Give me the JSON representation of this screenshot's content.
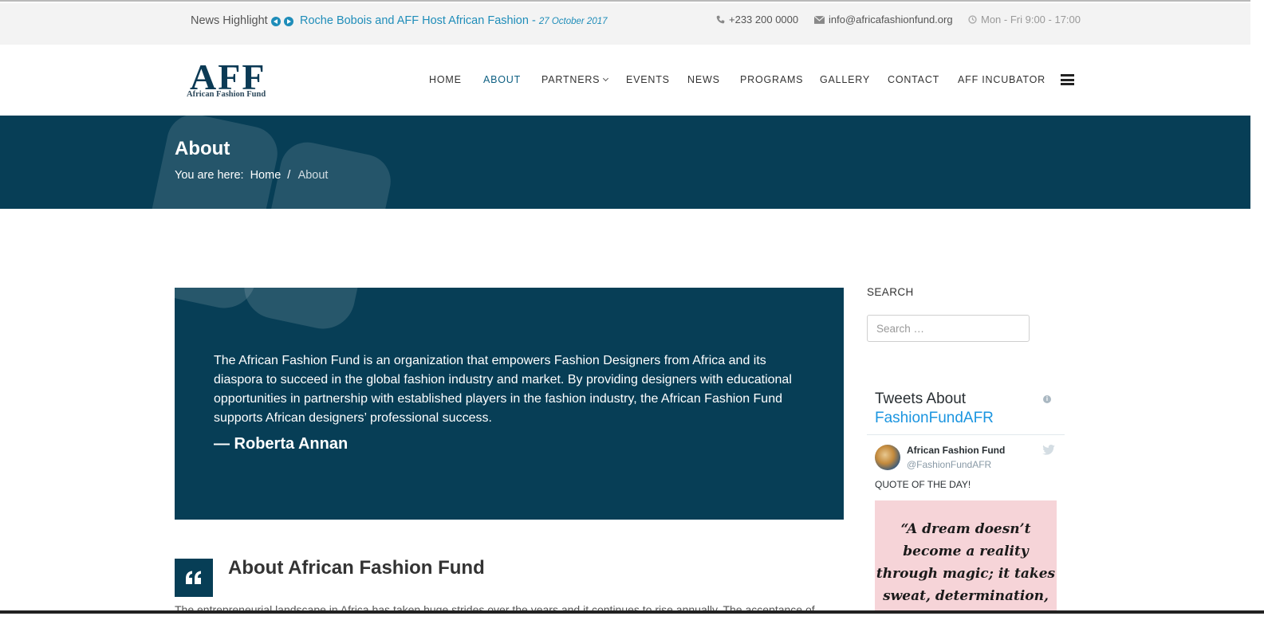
{
  "topbar": {
    "news_label": "News Highlight",
    "news_title": "Roche Bobois and AFF Host African Fashion",
    "news_dash": " - ",
    "news_date": "27 October 2017",
    "phone": "+233 200 0000",
    "email": "info@africafashionfund.org",
    "hours": "Mon - Fri 9:00 - 17:00"
  },
  "logo": {
    "mark": "AFF",
    "subtitle": "African Fashion Fund"
  },
  "nav": {
    "items": [
      {
        "label": "HOME"
      },
      {
        "label": "ABOUT"
      },
      {
        "label": "PARTNERS"
      },
      {
        "label": "EVENTS"
      },
      {
        "label": "NEWS"
      },
      {
        "label": "PROGRAMS"
      },
      {
        "label": "GALLERY"
      },
      {
        "label": "CONTACT"
      },
      {
        "label": "AFF INCUBATOR"
      }
    ],
    "active": "ABOUT"
  },
  "hero": {
    "title": "About",
    "breadcrumb_prefix": "You are here:",
    "breadcrumb_home": "Home",
    "breadcrumb_separator": "/",
    "breadcrumb_current": "About"
  },
  "quote": {
    "text": "The African Fashion Fund is an organization that empowers Fashion Designers from Africa and its diaspora to succeed in the global fashion industry and market. By providing designers with educational opportunities in partnership with established players in the fashion industry, the African Fashion Fund supports African designers’ professional success.",
    "author": "— Roberta Annan"
  },
  "about": {
    "heading": "About African Fashion Fund",
    "paragraph": "The entrepreneurial landscape in Africa has taken huge strides over the years and it continues to rise annually. The acceptance of"
  },
  "sidebar": {
    "search_label": "SEARCH",
    "search_placeholder": "Search …",
    "search_value": "",
    "tweets": {
      "title_prefix": "Tweets About",
      "title_handle": "FashionFundAFR",
      "info_icon": "i",
      "author_name": "African Fashion Fund",
      "author_handle": "@FashionFundAFR",
      "text": "QUOTE OF THE DAY!",
      "image_quote": "“A dream doesn’t become a reality through magic; it takes sweat, determination,"
    }
  },
  "colors": {
    "brand_dark": "#073e56",
    "link_blue": "#1f8db9",
    "twitter_blue": "#1b95e0",
    "topbar_bg": "#f3f3f3"
  },
  "icons": {
    "news_prev": "chevron-left-circle-icon",
    "news_next": "chevron-right-circle-icon",
    "phone": "phone-icon",
    "email": "envelope-icon",
    "hours": "clock-icon",
    "menu": "hamburger-icon",
    "about": "quote-icon",
    "twitter": "twitter-bird-icon"
  }
}
